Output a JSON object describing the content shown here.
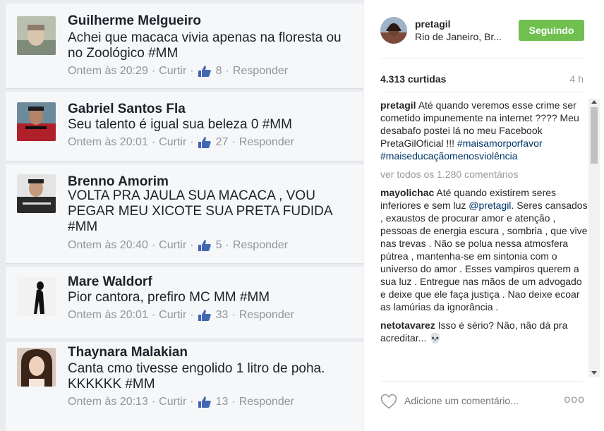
{
  "facebook": {
    "comments": [
      {
        "name": "Guilherme Melgueiro",
        "text": "Achei que macaca vivia apenas na floresta ou no Zoológico #MM",
        "time": "Ontem às 20:29",
        "like_label": "Curtir",
        "likes": "8",
        "reply_label": "Responder"
      },
      {
        "name": "Gabriel Santos Fla",
        "text": "Seu talento é igual sua beleza 0 #MM",
        "time": "Ontem às 20:01",
        "like_label": "Curtir",
        "likes": "27",
        "reply_label": "Responder"
      },
      {
        "name": "Brenno Amorim",
        "text": "VOLTA PRA JAULA SUA MACACA , VOU PEGAR MEU XICOTE SUA PRETA FUDIDA #MM",
        "time": "Ontem às 20:40",
        "like_label": "Curtir",
        "likes": "5",
        "reply_label": "Responder"
      },
      {
        "name": "Mare Waldorf",
        "text": "Pior cantora, prefiro MC MM #MM",
        "time": "Ontem às 20:01",
        "like_label": "Curtir",
        "likes": "33",
        "reply_label": "Responder"
      },
      {
        "name": "Thaynara Malakian",
        "text": "Canta cmo tivesse engolido 1 litro de poha. KKKKKK #MM",
        "time": "Ontem às 20:13",
        "like_label": "Curtir",
        "likes": "13",
        "reply_label": "Responder"
      }
    ],
    "separator": "·",
    "colors": {
      "background": "#e9ebee",
      "card": "#f6f7f9",
      "meta": "#90949c",
      "like_icon": "#4267b2"
    }
  },
  "instagram": {
    "username": "pretagil",
    "location": "Rio de Janeiro, Br...",
    "follow_label": "Seguindo",
    "likes": "4.313 curtidas",
    "age": "4 h",
    "caption": {
      "user": "pretagil",
      "text": "Até quando veremos esse crime ser cometido impunemente na internet ???? Meu desabafo postei lá no meu Facebook PretaGilOficial !!!",
      "hashtag1": "#maisamorporfavor",
      "hashtag2": "#maiseducaçãomenosviolência"
    },
    "view_all": "ver todos os 1.280 comentários",
    "comments": [
      {
        "user": "mayolichac",
        "text_before": "Até quando existirem seres inferiores e sem luz",
        "mention": "@pretagil",
        "text_after": ". Seres cansados , exaustos de procurar amor e atenção , pessoas de energia escura , sombria , que vive nas trevas . Não se polua nessa atmosfera pútrea , mantenha-se em sintonia com o universo do amor . Esses vampiros querem a sua luz . Entregue nas mãos de um advogado e deixe que ele faça justiça . Nao deixe ecoar as lamúrias da ignorância ."
      },
      {
        "user": "netotavarez",
        "text": "Isso é sério? Não, não dá pra acreditar... 💀"
      }
    ],
    "add_comment_placeholder": "Adicione um comentário...",
    "more_label": "ooo",
    "colors": {
      "follow": "#70c050",
      "link": "#003569",
      "muted": "#999999"
    }
  }
}
